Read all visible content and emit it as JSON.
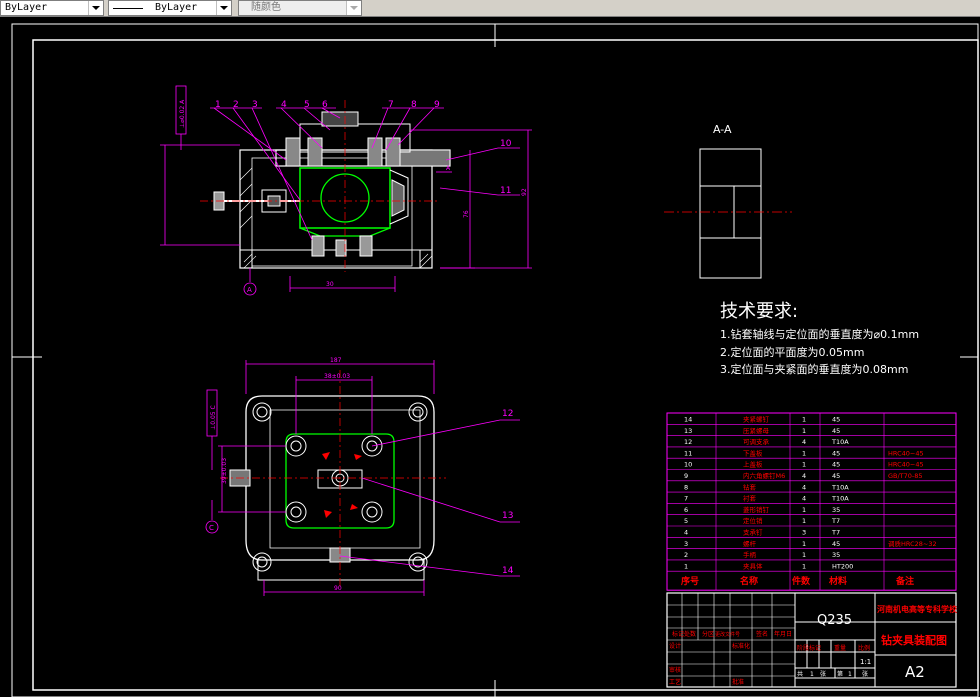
{
  "toolbar": {
    "linetype": "ByLayer",
    "lineweight": "ByLayer",
    "plotstyle": "随颜色"
  },
  "colors": {
    "background": "#000000",
    "frame": "#ffffff",
    "green": "#00ff00",
    "magenta": "#ff00ff",
    "red": "#ff0000",
    "yellow": "#ffff00",
    "cyan": "#00ffff"
  },
  "section_label": "A-A",
  "tech": {
    "title": "技术要求:",
    "req1": "1.钻套轴线与定位面的垂直度为⌀0.1mm",
    "req2": "2.定位面的平面度为0.05mm",
    "req3": "3.定位面与夹紧面的垂直度为0.08mm"
  },
  "front_view": {
    "callouts": [
      "1",
      "2",
      "3",
      "4",
      "5",
      "6",
      "7",
      "8",
      "9",
      "10",
      "11"
    ],
    "dim_bottom": "30",
    "dim_height_76": "76",
    "dim_height_92": "92",
    "datum_note": "⊥⌀0.02 A",
    "datum_label": "A"
  },
  "top_view": {
    "callouts": [
      "12",
      "13",
      "14"
    ],
    "dim_top_width": "187",
    "dim_hole_spacing": "38±0.03",
    "dim_bottom": "90",
    "dim_left": "39±0.03",
    "datum_note": "⊥0.05 C",
    "datum_label": "C"
  },
  "bom": {
    "rows": [
      {
        "no": "14",
        "name": "夹紧螺钉",
        "qty": "1",
        "mat": "45",
        "note": ""
      },
      {
        "no": "13",
        "name": "压紧螺母",
        "qty": "1",
        "mat": "45",
        "note": ""
      },
      {
        "no": "12",
        "name": "可调支承",
        "qty": "4",
        "mat": "T10A",
        "note": ""
      },
      {
        "no": "11",
        "name": "下盖板",
        "qty": "1",
        "mat": "45",
        "note": "HRC40~45"
      },
      {
        "no": "10",
        "name": "上盖板",
        "qty": "1",
        "mat": "45",
        "note": "HRC40~45"
      },
      {
        "no": "9",
        "name": "内六角螺钉M6",
        "qty": "4",
        "mat": "45",
        "note": "GB/T70-85"
      },
      {
        "no": "8",
        "name": "钻套",
        "qty": "4",
        "mat": "T10A",
        "note": ""
      },
      {
        "no": "7",
        "name": "衬套",
        "qty": "4",
        "mat": "T10A",
        "note": ""
      },
      {
        "no": "6",
        "name": "菱形销钉",
        "qty": "1",
        "mat": "35",
        "note": ""
      },
      {
        "no": "5",
        "name": "定位销",
        "qty": "1",
        "mat": "T7",
        "note": ""
      },
      {
        "no": "4",
        "name": "支承钉",
        "qty": "3",
        "mat": "T7",
        "note": ""
      },
      {
        "no": "3",
        "name": "螺杆",
        "qty": "1",
        "mat": "45",
        "note": "调质HRC28~32"
      },
      {
        "no": "2",
        "name": "手柄",
        "qty": "1",
        "mat": "35",
        "note": ""
      },
      {
        "no": "1",
        "name": "夹具体",
        "qty": "1",
        "mat": "HT200",
        "note": ""
      }
    ],
    "headers": {
      "no": "序号",
      "name": "名称",
      "qty": "件数",
      "mat": "材料",
      "note": "备注"
    }
  },
  "title_block": {
    "material": "Q235",
    "school": "河南机电高等专科学校",
    "drawing_title": "钻夹具装配图",
    "scale": "1:1",
    "sheet_size": "A2",
    "row_labels": [
      "标记",
      "处数",
      "分区",
      "更改文件号",
      "签名",
      "年月日"
    ],
    "design": "设计",
    "std": "标准化",
    "check": "审核",
    "process": "工艺",
    "approve": "批准",
    "stage": "阶段标记",
    "weight": "重量",
    "ratio": "比例",
    "total": "共",
    "sheet": "张",
    "page": "第",
    "one": "1"
  }
}
